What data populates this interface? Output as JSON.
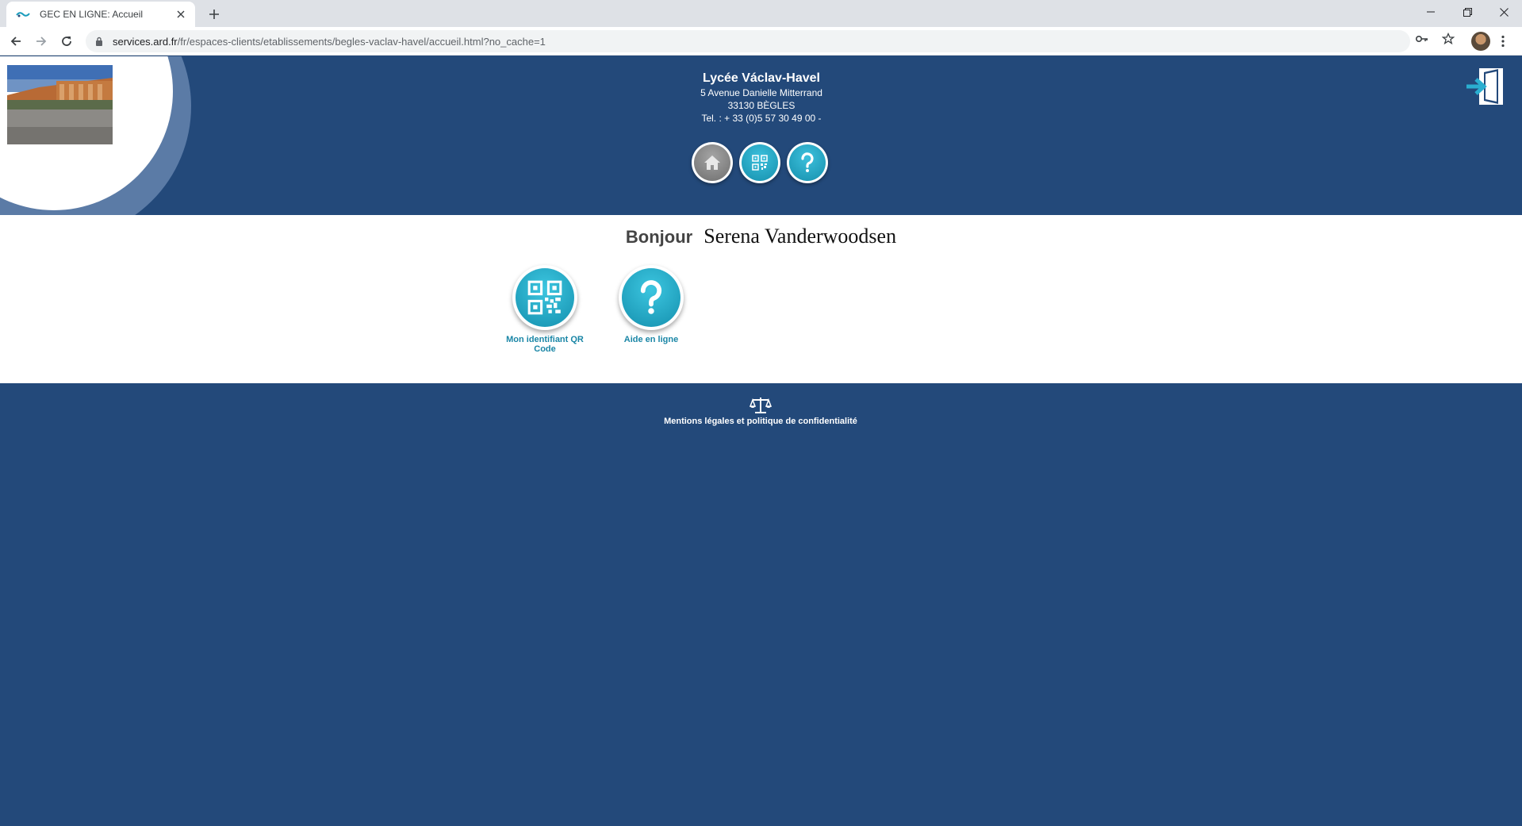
{
  "browser": {
    "tab_title": "GEC EN LIGNE: Accueil",
    "url_host": "services.ard.fr",
    "url_path": "/fr/espaces-clients/etablissements/begles-vaclav-havel/accueil.html?no_cache=1"
  },
  "header": {
    "school_name": "Lycée Václav-Havel",
    "address_line1": "5 Avenue Danielle Mitterrand",
    "address_line2": "33130 BÈGLES",
    "phone": "Tel. : + 33 (0)5 57 30 49 00 -",
    "nav_icons": [
      "home-icon",
      "qr-code-icon",
      "help-icon"
    ],
    "logout_icon": "logout-icon"
  },
  "content": {
    "greeting_word": "Bonjour",
    "user_name": "Serena Vanderwoodsen",
    "actions": [
      {
        "label": "Mon identifiant QR Code",
        "icon": "qr-code-icon"
      },
      {
        "label": "Aide en ligne",
        "icon": "help-icon"
      }
    ]
  },
  "footer": {
    "legal_label": "Mentions légales et politique de confidentialité",
    "legal_icon": "scales-icon"
  },
  "colors": {
    "header_blue": "#23497a",
    "accent_teal": "#1a9cbc",
    "label_teal": "#1a86a6"
  }
}
